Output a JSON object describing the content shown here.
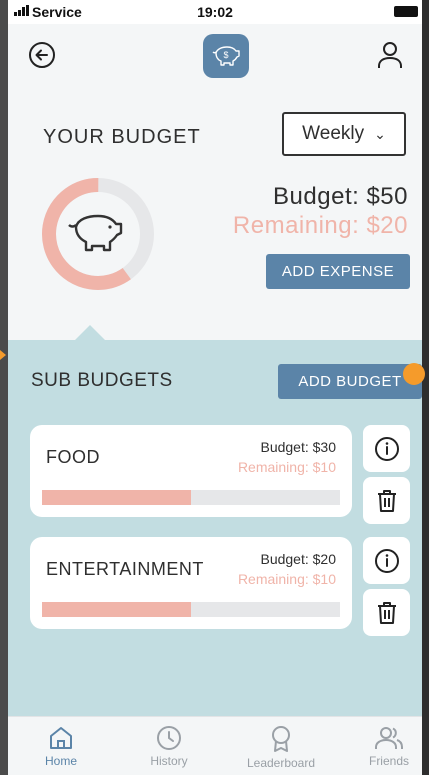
{
  "status_bar": {
    "carrier": "Service",
    "time": "19:02"
  },
  "header": {
    "back_icon": "back-arrow-icon",
    "logo_icon": "piggy-bank-dollar-icon",
    "profile_icon": "user-icon"
  },
  "budget": {
    "title": "YOUR BUDGET",
    "period": "Weekly",
    "budget_text": "Budget: $50",
    "remaining_text": "Remaining: $20",
    "spent_fraction": 0.6,
    "add_expense_label": "ADD EXPENSE"
  },
  "sub_budgets": {
    "title": "SUB BUDGETS",
    "add_budget_label": "ADD BUDGET",
    "items": [
      {
        "name": "FOOD",
        "budget_text": "Budget: $30",
        "remaining_text": "Remaining: $10",
        "progress": 0.5
      },
      {
        "name": "ENTERTAINMENT",
        "budget_text": "Budget: $20",
        "remaining_text": "Remaining: $10",
        "progress": 0.5
      }
    ]
  },
  "tabs": [
    {
      "label": "Home",
      "icon": "home-icon",
      "active": true
    },
    {
      "label": "History",
      "icon": "clock-icon",
      "active": false
    },
    {
      "label": "Leaderboard",
      "icon": "award-icon",
      "active": false
    },
    {
      "label": "Friends",
      "icon": "users-icon",
      "active": false
    }
  ],
  "colors": {
    "accent": "#5b84a8",
    "remaining": "#f0b4a9",
    "panel": "#c2dde1",
    "highlight": "#f59b2b"
  }
}
